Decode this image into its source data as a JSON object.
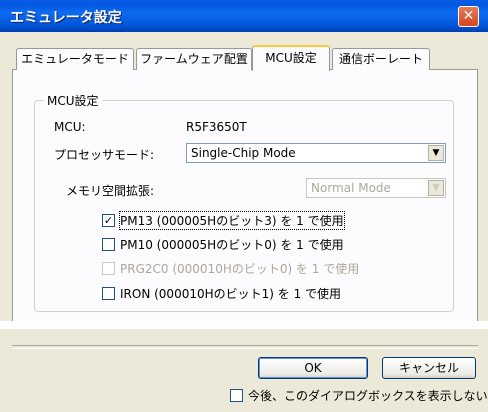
{
  "window": {
    "title": "エミュレータ設定",
    "close_symbol": "✕"
  },
  "tabs": [
    {
      "label": "エミュレータモード",
      "active": false
    },
    {
      "label": "ファームウェア配置",
      "active": false
    },
    {
      "label": "MCU設定",
      "active": true
    },
    {
      "label": "通信ボーレート",
      "active": false
    }
  ],
  "group": {
    "legend": "MCU設定",
    "mcu_label": "MCU:",
    "mcu_value": "R5F3650T",
    "processor_mode_label": "プロセッサモード:",
    "processor_mode_value": "Single-Chip Mode",
    "memory_expansion_label": "メモリ空間拡張:",
    "memory_expansion_value": "Normal Mode",
    "checkboxes": [
      {
        "label": "PM13 (000005Hのビット3) を 1 で使用",
        "checked": true,
        "enabled": true
      },
      {
        "label": "PM10 (000005Hのビット0) を 1 で使用",
        "checked": false,
        "enabled": true
      },
      {
        "label": "PRG2C0 (000010Hのビット0) を 1 で使用",
        "checked": false,
        "enabled": false
      },
      {
        "label": "IRON (000010Hのビット1) を 1 で使用",
        "checked": false,
        "enabled": true
      }
    ]
  },
  "buttons": {
    "ok": "OK",
    "cancel": "キャンセル"
  },
  "footer": {
    "dont_show_label": "今後、このダイアログボックスを表示しない",
    "dont_show_checked": false
  },
  "icons": {
    "dropdown": "▼",
    "checkmark": "✓"
  }
}
